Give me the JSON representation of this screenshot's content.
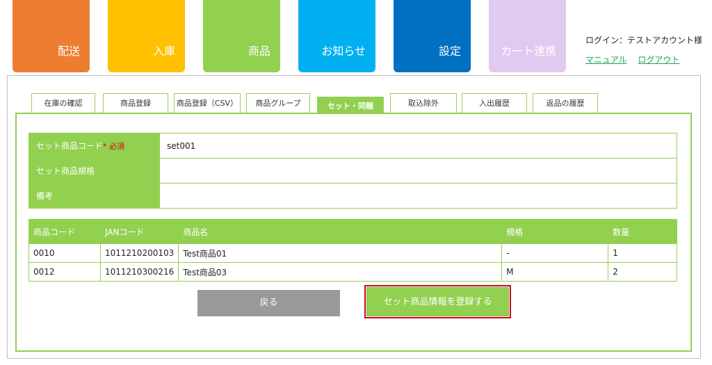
{
  "nav": [
    {
      "label": "配送",
      "color": "#ed7d31"
    },
    {
      "label": "入庫",
      "color": "#ffc000"
    },
    {
      "label": "商品",
      "color": "#92d050"
    },
    {
      "label": "お知らせ",
      "color": "#00b0f0"
    },
    {
      "label": "設定",
      "color": "#0070c0"
    },
    {
      "label": "カート連携",
      "color": "#e0caf0"
    }
  ],
  "header": {
    "login_text": "ログイン：テストアカウント様",
    "manual_link": "マニュアル",
    "logout_link": "ログアウト"
  },
  "tabs": [
    {
      "label": "在庫の確認"
    },
    {
      "label": "商品登録"
    },
    {
      "label": "商品登録（CSV）"
    },
    {
      "label": "商品グループ"
    },
    {
      "label": "セット・同梱",
      "active": true
    },
    {
      "label": "取込除外"
    },
    {
      "label": "入出履歴"
    },
    {
      "label": "返品の履歴"
    }
  ],
  "form": {
    "set_code_label": "セット商品コード",
    "required_mark": "* 必須",
    "set_code_value": "set001",
    "set_spec_label": "セット商品規格",
    "set_spec_value": "",
    "memo_label": "備考",
    "memo_value": ""
  },
  "items": {
    "headers": [
      "商品コード",
      "JANコード",
      "商品名",
      "規格",
      "数量"
    ],
    "rows": [
      [
        "0010",
        "1011210200103",
        "Test商品01",
        "-",
        "1"
      ],
      [
        "0012",
        "1011210300216",
        "Test商品03",
        "M",
        "2"
      ]
    ]
  },
  "buttons": {
    "back": "戻る",
    "save": "セット商品情報を登録する"
  },
  "colors": {
    "accent": "#92d050",
    "highlight": "#d0021b"
  }
}
